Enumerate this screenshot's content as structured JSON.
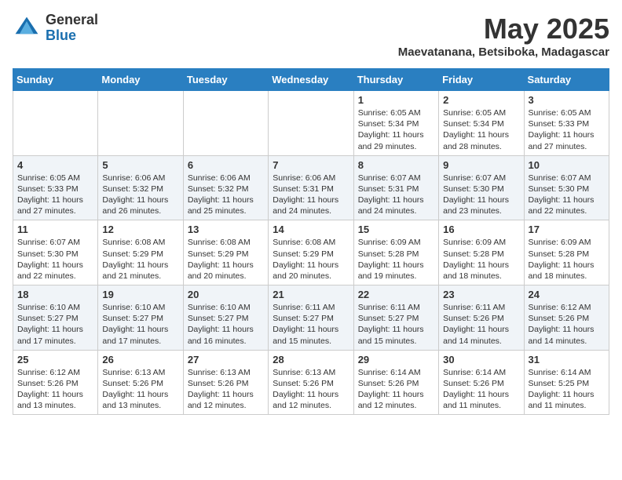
{
  "logo": {
    "general": "General",
    "blue": "Blue"
  },
  "title": "May 2025",
  "subtitle": "Maevatanana, Betsiboka, Madagascar",
  "headers": [
    "Sunday",
    "Monday",
    "Tuesday",
    "Wednesday",
    "Thursday",
    "Friday",
    "Saturday"
  ],
  "weeks": [
    [
      {
        "day": "",
        "content": ""
      },
      {
        "day": "",
        "content": ""
      },
      {
        "day": "",
        "content": ""
      },
      {
        "day": "",
        "content": ""
      },
      {
        "day": "1",
        "content": "Sunrise: 6:05 AM\nSunset: 5:34 PM\nDaylight: 11 hours and 29 minutes."
      },
      {
        "day": "2",
        "content": "Sunrise: 6:05 AM\nSunset: 5:34 PM\nDaylight: 11 hours and 28 minutes."
      },
      {
        "day": "3",
        "content": "Sunrise: 6:05 AM\nSunset: 5:33 PM\nDaylight: 11 hours and 27 minutes."
      }
    ],
    [
      {
        "day": "4",
        "content": "Sunrise: 6:05 AM\nSunset: 5:33 PM\nDaylight: 11 hours and 27 minutes."
      },
      {
        "day": "5",
        "content": "Sunrise: 6:06 AM\nSunset: 5:32 PM\nDaylight: 11 hours and 26 minutes."
      },
      {
        "day": "6",
        "content": "Sunrise: 6:06 AM\nSunset: 5:32 PM\nDaylight: 11 hours and 25 minutes."
      },
      {
        "day": "7",
        "content": "Sunrise: 6:06 AM\nSunset: 5:31 PM\nDaylight: 11 hours and 24 minutes."
      },
      {
        "day": "8",
        "content": "Sunrise: 6:07 AM\nSunset: 5:31 PM\nDaylight: 11 hours and 24 minutes."
      },
      {
        "day": "9",
        "content": "Sunrise: 6:07 AM\nSunset: 5:30 PM\nDaylight: 11 hours and 23 minutes."
      },
      {
        "day": "10",
        "content": "Sunrise: 6:07 AM\nSunset: 5:30 PM\nDaylight: 11 hours and 22 minutes."
      }
    ],
    [
      {
        "day": "11",
        "content": "Sunrise: 6:07 AM\nSunset: 5:30 PM\nDaylight: 11 hours and 22 minutes."
      },
      {
        "day": "12",
        "content": "Sunrise: 6:08 AM\nSunset: 5:29 PM\nDaylight: 11 hours and 21 minutes."
      },
      {
        "day": "13",
        "content": "Sunrise: 6:08 AM\nSunset: 5:29 PM\nDaylight: 11 hours and 20 minutes."
      },
      {
        "day": "14",
        "content": "Sunrise: 6:08 AM\nSunset: 5:29 PM\nDaylight: 11 hours and 20 minutes."
      },
      {
        "day": "15",
        "content": "Sunrise: 6:09 AM\nSunset: 5:28 PM\nDaylight: 11 hours and 19 minutes."
      },
      {
        "day": "16",
        "content": "Sunrise: 6:09 AM\nSunset: 5:28 PM\nDaylight: 11 hours and 18 minutes."
      },
      {
        "day": "17",
        "content": "Sunrise: 6:09 AM\nSunset: 5:28 PM\nDaylight: 11 hours and 18 minutes."
      }
    ],
    [
      {
        "day": "18",
        "content": "Sunrise: 6:10 AM\nSunset: 5:27 PM\nDaylight: 11 hours and 17 minutes."
      },
      {
        "day": "19",
        "content": "Sunrise: 6:10 AM\nSunset: 5:27 PM\nDaylight: 11 hours and 17 minutes."
      },
      {
        "day": "20",
        "content": "Sunrise: 6:10 AM\nSunset: 5:27 PM\nDaylight: 11 hours and 16 minutes."
      },
      {
        "day": "21",
        "content": "Sunrise: 6:11 AM\nSunset: 5:27 PM\nDaylight: 11 hours and 15 minutes."
      },
      {
        "day": "22",
        "content": "Sunrise: 6:11 AM\nSunset: 5:27 PM\nDaylight: 11 hours and 15 minutes."
      },
      {
        "day": "23",
        "content": "Sunrise: 6:11 AM\nSunset: 5:26 PM\nDaylight: 11 hours and 14 minutes."
      },
      {
        "day": "24",
        "content": "Sunrise: 6:12 AM\nSunset: 5:26 PM\nDaylight: 11 hours and 14 minutes."
      }
    ],
    [
      {
        "day": "25",
        "content": "Sunrise: 6:12 AM\nSunset: 5:26 PM\nDaylight: 11 hours and 13 minutes."
      },
      {
        "day": "26",
        "content": "Sunrise: 6:13 AM\nSunset: 5:26 PM\nDaylight: 11 hours and 13 minutes."
      },
      {
        "day": "27",
        "content": "Sunrise: 6:13 AM\nSunset: 5:26 PM\nDaylight: 11 hours and 12 minutes."
      },
      {
        "day": "28",
        "content": "Sunrise: 6:13 AM\nSunset: 5:26 PM\nDaylight: 11 hours and 12 minutes."
      },
      {
        "day": "29",
        "content": "Sunrise: 6:14 AM\nSunset: 5:26 PM\nDaylight: 11 hours and 12 minutes."
      },
      {
        "day": "30",
        "content": "Sunrise: 6:14 AM\nSunset: 5:26 PM\nDaylight: 11 hours and 11 minutes."
      },
      {
        "day": "31",
        "content": "Sunrise: 6:14 AM\nSunset: 5:25 PM\nDaylight: 11 hours and 11 minutes."
      }
    ]
  ]
}
